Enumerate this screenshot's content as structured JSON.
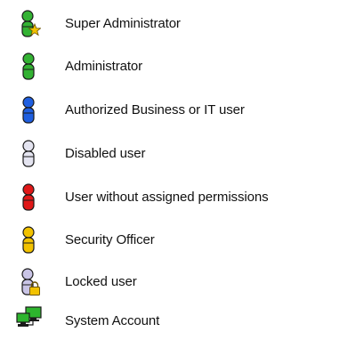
{
  "legend": {
    "items": [
      {
        "label": "Super Administrator",
        "icon": "user-green-star-icon",
        "color": "#33b233",
        "badge_color": "#f2c200"
      },
      {
        "label": "Administrator",
        "icon": "user-green-icon",
        "color": "#33b233"
      },
      {
        "label": "Authorized Business or IT user",
        "icon": "user-blue-icon",
        "color": "#1f5fe0"
      },
      {
        "label": "Disabled user",
        "icon": "user-white-icon",
        "color": "#e4e4f0"
      },
      {
        "label": "User without assigned permissions",
        "icon": "user-red-icon",
        "color": "#e01818"
      },
      {
        "label": "Security Officer",
        "icon": "user-yellow-icon",
        "color": "#f2c200"
      },
      {
        "label": "Locked user",
        "icon": "user-lavender-lock-icon",
        "color": "#c9c4e6",
        "badge_color": "#f2c200"
      },
      {
        "label": "System Account",
        "icon": "system-account-computers-icon",
        "color": "#2db52d"
      }
    ]
  }
}
